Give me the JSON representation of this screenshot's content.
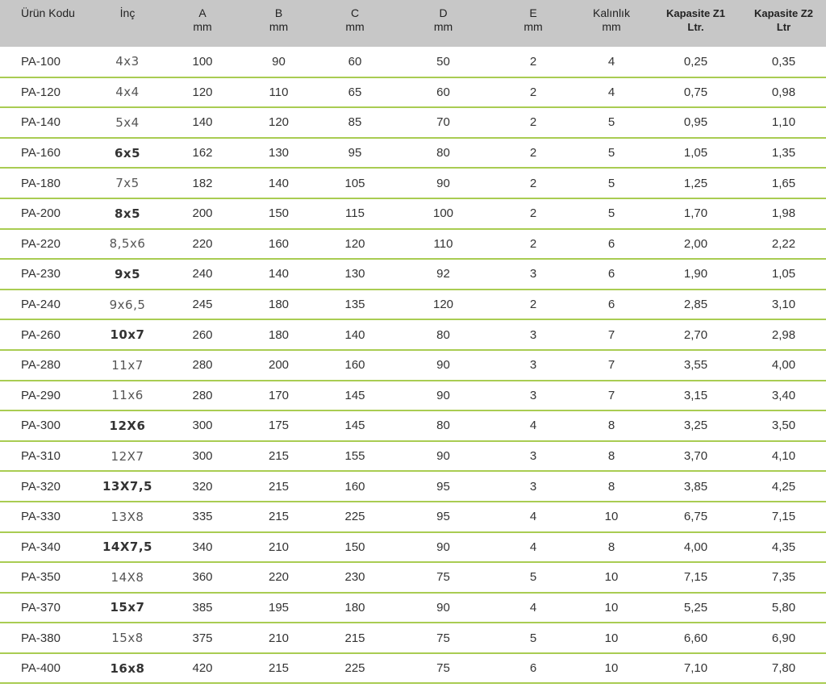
{
  "table": {
    "headers": [
      {
        "line1": "Ürün Kodu",
        "line2": "",
        "bold": false
      },
      {
        "line1": "İnç",
        "line2": "",
        "bold": false
      },
      {
        "line1": "A",
        "line2": "mm",
        "bold": false
      },
      {
        "line1": "B",
        "line2": "mm",
        "bold": false
      },
      {
        "line1": "C",
        "line2": "mm",
        "bold": false
      },
      {
        "line1": "D",
        "line2": "mm",
        "bold": false
      },
      {
        "line1": "E",
        "line2": "mm",
        "bold": false
      },
      {
        "line1": "Kalınlık",
        "line2": "mm",
        "bold": false
      },
      {
        "line1": "Kapasite Z1",
        "line2": "Ltr.",
        "bold": true
      },
      {
        "line1": "Kapasite Z2",
        "line2": "Ltr",
        "bold": true
      }
    ],
    "rows": [
      {
        "code": "PA-100",
        "inch": "4x3",
        "inch_bold": false,
        "a": "100",
        "b": "90",
        "c": "60",
        "d": "50",
        "e": "2",
        "thickness": "4",
        "z1": "0,25",
        "z2": "0,35"
      },
      {
        "code": "PA-120",
        "inch": "4x4",
        "inch_bold": false,
        "a": "120",
        "b": "110",
        "c": "65",
        "d": "60",
        "e": "2",
        "thickness": "4",
        "z1": "0,75",
        "z2": "0,98"
      },
      {
        "code": "PA-140",
        "inch": "5x4",
        "inch_bold": false,
        "a": "140",
        "b": "120",
        "c": "85",
        "d": "70",
        "e": "2",
        "thickness": "5",
        "z1": "0,95",
        "z2": "1,10"
      },
      {
        "code": "PA-160",
        "inch": "6x5",
        "inch_bold": true,
        "a": "162",
        "b": "130",
        "c": "95",
        "d": "80",
        "e": "2",
        "thickness": "5",
        "z1": "1,05",
        "z2": "1,35"
      },
      {
        "code": "PA-180",
        "inch": "7x5",
        "inch_bold": false,
        "a": "182",
        "b": "140",
        "c": "105",
        "d": "90",
        "e": "2",
        "thickness": "5",
        "z1": "1,25",
        "z2": "1,65"
      },
      {
        "code": "PA-200",
        "inch": "8x5",
        "inch_bold": true,
        "a": "200",
        "b": "150",
        "c": "115",
        "d": "100",
        "e": "2",
        "thickness": "5",
        "z1": "1,70",
        "z2": "1,98"
      },
      {
        "code": "PA-220",
        "inch": "8,5x6",
        "inch_bold": false,
        "a": "220",
        "b": "160",
        "c": "120",
        "d": "110",
        "e": "2",
        "thickness": "6",
        "z1": "2,00",
        "z2": "2,22"
      },
      {
        "code": "PA-230",
        "inch": "9x5",
        "inch_bold": true,
        "a": "240",
        "b": "140",
        "c": "130",
        "d": "92",
        "e": "3",
        "thickness": "6",
        "z1": "1,90",
        "z2": "1,05"
      },
      {
        "code": "PA-240",
        "inch": "9x6,5",
        "inch_bold": false,
        "a": "245",
        "b": "180",
        "c": "135",
        "d": "120",
        "e": "2",
        "thickness": "6",
        "z1": "2,85",
        "z2": "3,10"
      },
      {
        "code": "PA-260",
        "inch": "10x7",
        "inch_bold": true,
        "a": "260",
        "b": "180",
        "c": "140",
        "d": "80",
        "e": "3",
        "thickness": "7",
        "z1": "2,70",
        "z2": "2,98"
      },
      {
        "code": "PA-280",
        "inch": "11x7",
        "inch_bold": false,
        "a": "280",
        "b": "200",
        "c": "160",
        "d": "90",
        "e": "3",
        "thickness": "7",
        "z1": "3,55",
        "z2": "4,00"
      },
      {
        "code": "PA-290",
        "inch": "11x6",
        "inch_bold": false,
        "a": "280",
        "b": "170",
        "c": "145",
        "d": "90",
        "e": "3",
        "thickness": "7",
        "z1": "3,15",
        "z2": "3,40"
      },
      {
        "code": "PA-300",
        "inch": "12X6",
        "inch_bold": true,
        "a": "300",
        "b": "175",
        "c": "145",
        "d": "80",
        "e": "4",
        "thickness": "8",
        "z1": "3,25",
        "z2": "3,50"
      },
      {
        "code": "PA-310",
        "inch": "12X7",
        "inch_bold": false,
        "a": "300",
        "b": "215",
        "c": "155",
        "d": "90",
        "e": "3",
        "thickness": "8",
        "z1": "3,70",
        "z2": "4,10"
      },
      {
        "code": "PA-320",
        "inch": "13X7,5",
        "inch_bold": true,
        "a": "320",
        "b": "215",
        "c": "160",
        "d": "95",
        "e": "3",
        "thickness": "8",
        "z1": "3,85",
        "z2": "4,25"
      },
      {
        "code": "PA-330",
        "inch": "13X8",
        "inch_bold": false,
        "a": "335",
        "b": "215",
        "c": "225",
        "d": "95",
        "e": "4",
        "thickness": "10",
        "z1": "6,75",
        "z2": "7,15"
      },
      {
        "code": "PA-340",
        "inch": "14X7,5",
        "inch_bold": true,
        "a": "340",
        "b": "210",
        "c": "150",
        "d": "90",
        "e": "4",
        "thickness": "8",
        "z1": "4,00",
        "z2": "4,35"
      },
      {
        "code": "PA-350",
        "inch": "14X8",
        "inch_bold": false,
        "a": "360",
        "b": "220",
        "c": "230",
        "d": "75",
        "e": "5",
        "thickness": "10",
        "z1": "7,15",
        "z2": "7,35"
      },
      {
        "code": "PA-370",
        "inch": "15x7",
        "inch_bold": true,
        "a": "385",
        "b": "195",
        "c": "180",
        "d": "90",
        "e": "4",
        "thickness": "10",
        "z1": "5,25",
        "z2": "5,80"
      },
      {
        "code": "PA-380",
        "inch": "15x8",
        "inch_bold": false,
        "a": "375",
        "b": "210",
        "c": "215",
        "d": "75",
        "e": "5",
        "thickness": "10",
        "z1": "6,60",
        "z2": "6,90"
      },
      {
        "code": "PA-400",
        "inch": "16x8",
        "inch_bold": true,
        "a": "420",
        "b": "215",
        "c": "225",
        "d": "75",
        "e": "6",
        "thickness": "10",
        "z1": "7,10",
        "z2": "7,80"
      }
    ]
  },
  "colors": {
    "header_bg": "#c7c7c7",
    "row_divider": "#a9cc52",
    "text": "#333333"
  }
}
